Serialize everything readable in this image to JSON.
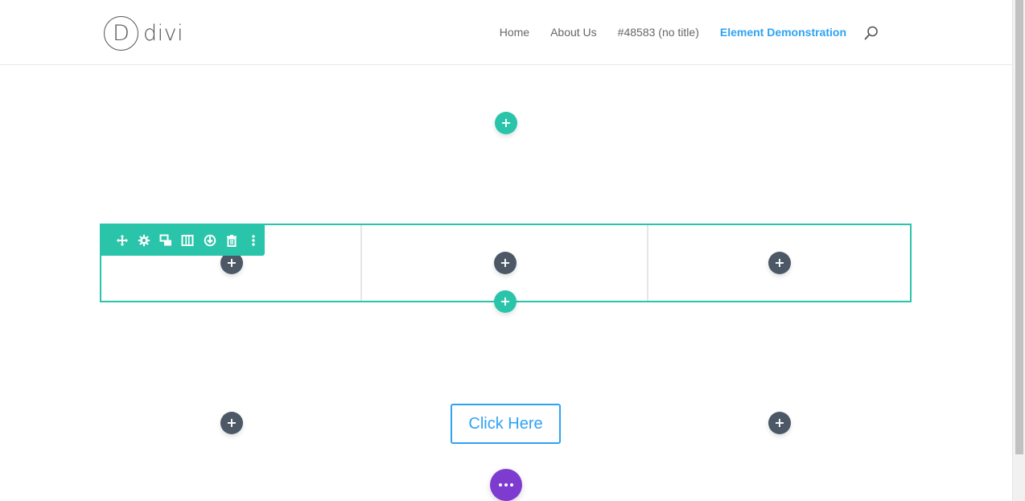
{
  "logo": {
    "letter": "D",
    "text": "divi"
  },
  "nav": {
    "items": [
      {
        "label": "Home",
        "active": false
      },
      {
        "label": "About Us",
        "active": false
      },
      {
        "label": "#48583 (no title)",
        "active": false
      },
      {
        "label": "Element Demonstration",
        "active": true
      }
    ],
    "search_icon": "search-icon"
  },
  "builder": {
    "add_symbol": "+",
    "row_toolbar_icons": [
      "move-icon",
      "gear-icon",
      "duplicate-icon",
      "columns-icon",
      "save-icon",
      "trash-icon",
      "more-vertical-icon"
    ],
    "button_label": "Click Here",
    "more_icon": "ellipsis-icon"
  },
  "colors": {
    "teal": "#29c4a9",
    "dark": "#4c5866",
    "accent_blue": "#2ea3f2",
    "purple": "#7e3bd0"
  }
}
